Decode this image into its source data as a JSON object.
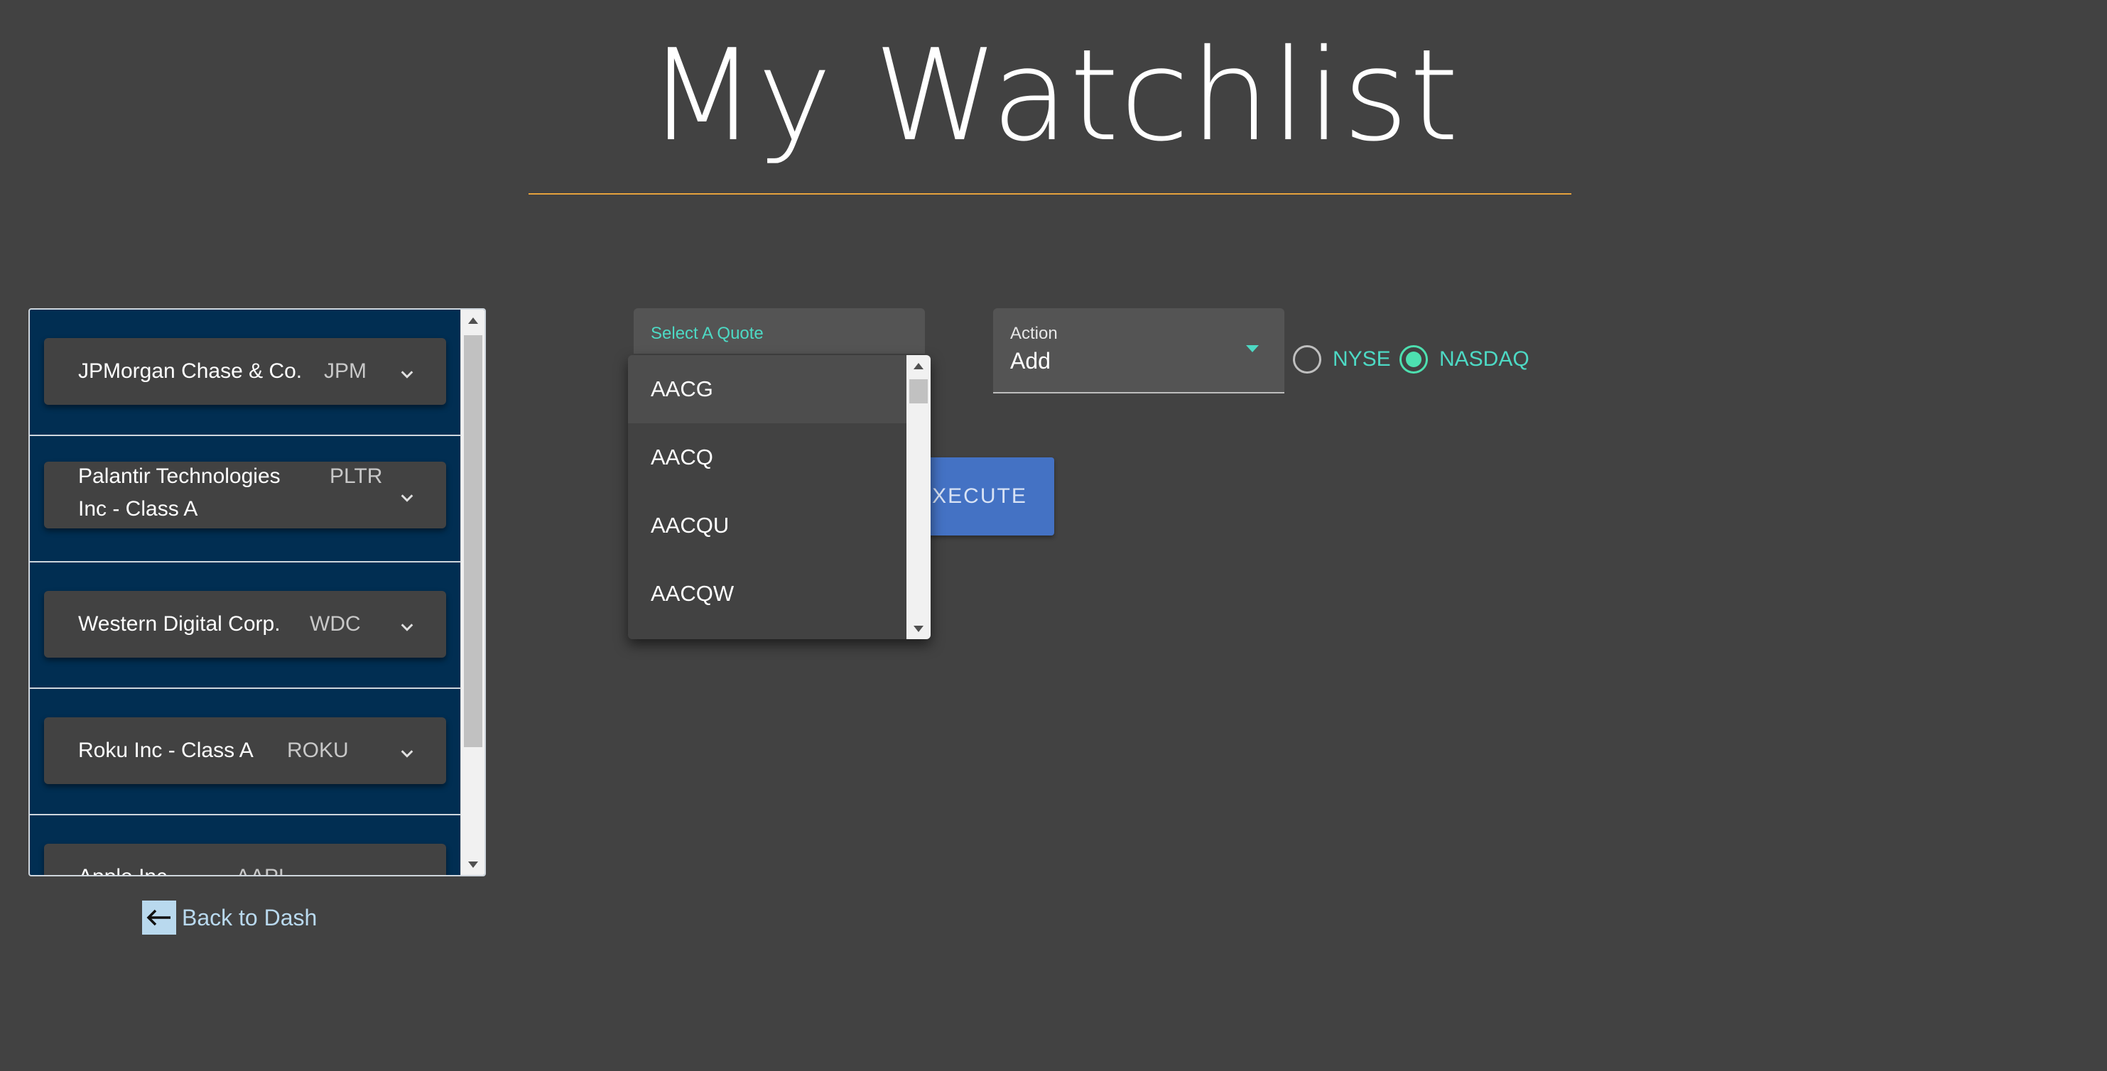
{
  "page": {
    "title": "My Watchlist"
  },
  "watchlist": {
    "items": [
      {
        "name": "JPMorgan Chase & Co.",
        "symbol": "JPM"
      },
      {
        "name": "Palantir Technologies Inc - Class A",
        "name_line1": "Palantir Technologies",
        "name_line2": "Inc - Class A",
        "symbol": "PLTR"
      },
      {
        "name": "Western Digital Corp.",
        "symbol": "WDC"
      },
      {
        "name": "Roku Inc - Class A",
        "symbol": "ROKU"
      },
      {
        "name": "Apple Inc",
        "symbol": "AAPL"
      }
    ]
  },
  "back_link": {
    "label": "Back to Dash"
  },
  "quote_select": {
    "label": "Select A Quote",
    "options": [
      "AACG",
      "AACQ",
      "AACQU",
      "AACQW"
    ]
  },
  "action_select": {
    "label": "Action",
    "value": "Add"
  },
  "exchange": {
    "options": [
      {
        "label": "NYSE",
        "checked": false
      },
      {
        "label": "NASDAQ",
        "checked": true
      }
    ]
  },
  "execute": {
    "label": "EXECUTE",
    "visible_label": "XECUTE"
  },
  "colors": {
    "background": "#424242",
    "accent_teal": "#4dd9c4",
    "title_rule": "#e6a23c",
    "panel_bg": "#012e52",
    "execute_button": "#4472c4"
  }
}
